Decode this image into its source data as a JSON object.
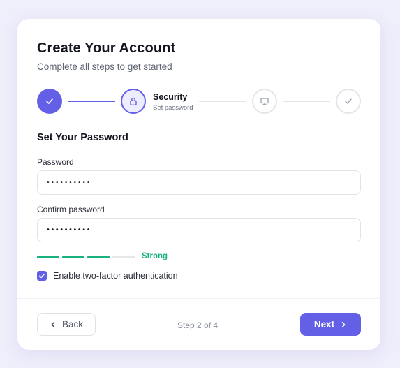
{
  "header": {
    "title": "Create Your Account",
    "subtitle": "Complete all steps to get started"
  },
  "stepper": {
    "steps": [
      {
        "state": "completed",
        "icon": "check-icon"
      },
      {
        "state": "active",
        "icon": "lock-icon",
        "label": "Security",
        "sublabel": "Set password"
      },
      {
        "state": "pending",
        "icon": "monitor-icon"
      },
      {
        "state": "pending",
        "icon": "check-icon"
      }
    ]
  },
  "form": {
    "section_title": "Set Your Password",
    "password": {
      "label": "Password",
      "value": "••••••••••"
    },
    "confirm_password": {
      "label": "Confirm password",
      "value": "••••••••••"
    },
    "strength": {
      "filled_segments": 3,
      "total_segments": 4,
      "label": "Strong"
    },
    "two_factor": {
      "label": "Enable two-factor authentication",
      "checked": true
    }
  },
  "footer": {
    "back_label": "Back",
    "step_indicator": "Step 2 of 4",
    "next_label": "Next"
  },
  "colors": {
    "accent": "#6360e7",
    "success": "#19b27d",
    "background": "#efeefb"
  }
}
